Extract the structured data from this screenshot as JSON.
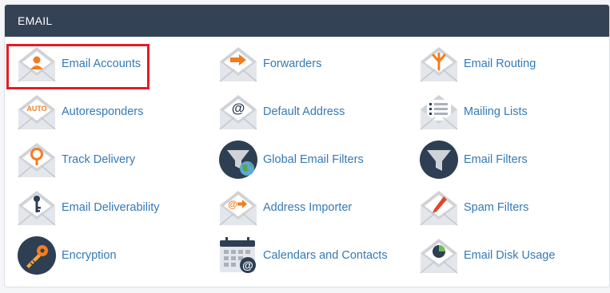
{
  "section": {
    "title": "EMAIL"
  },
  "items": [
    {
      "label": "Email Accounts",
      "icon": "envelope-user-icon"
    },
    {
      "label": "Forwarders",
      "icon": "envelope-arrow-icon"
    },
    {
      "label": "Email Routing",
      "icon": "envelope-routing-icon"
    },
    {
      "label": "Autoresponders",
      "icon": "envelope-auto-icon",
      "icon_text": "AUTO"
    },
    {
      "label": "Default Address",
      "icon": "envelope-at-icon"
    },
    {
      "label": "Mailing Lists",
      "icon": "envelope-list-icon"
    },
    {
      "label": "Track Delivery",
      "icon": "envelope-location-icon"
    },
    {
      "label": "Global Email Filters",
      "icon": "globe-filter-icon"
    },
    {
      "label": "Email Filters",
      "icon": "funnel-icon"
    },
    {
      "label": "Email Deliverability",
      "icon": "envelope-key-icon"
    },
    {
      "label": "Address Importer",
      "icon": "envelope-at-arrow-icon"
    },
    {
      "label": "Spam Filters",
      "icon": "envelope-pen-icon"
    },
    {
      "label": "Encryption",
      "icon": "key-icon"
    },
    {
      "label": "Calendars and Contacts",
      "icon": "calendar-at-icon"
    },
    {
      "label": "Email Disk Usage",
      "icon": "envelope-pie-icon"
    }
  ],
  "colors": {
    "header_bg": "#344255",
    "link": "#337ab7",
    "accent": "#f47c20",
    "highlight": "#e21d25",
    "navy": "#2e3e53"
  }
}
